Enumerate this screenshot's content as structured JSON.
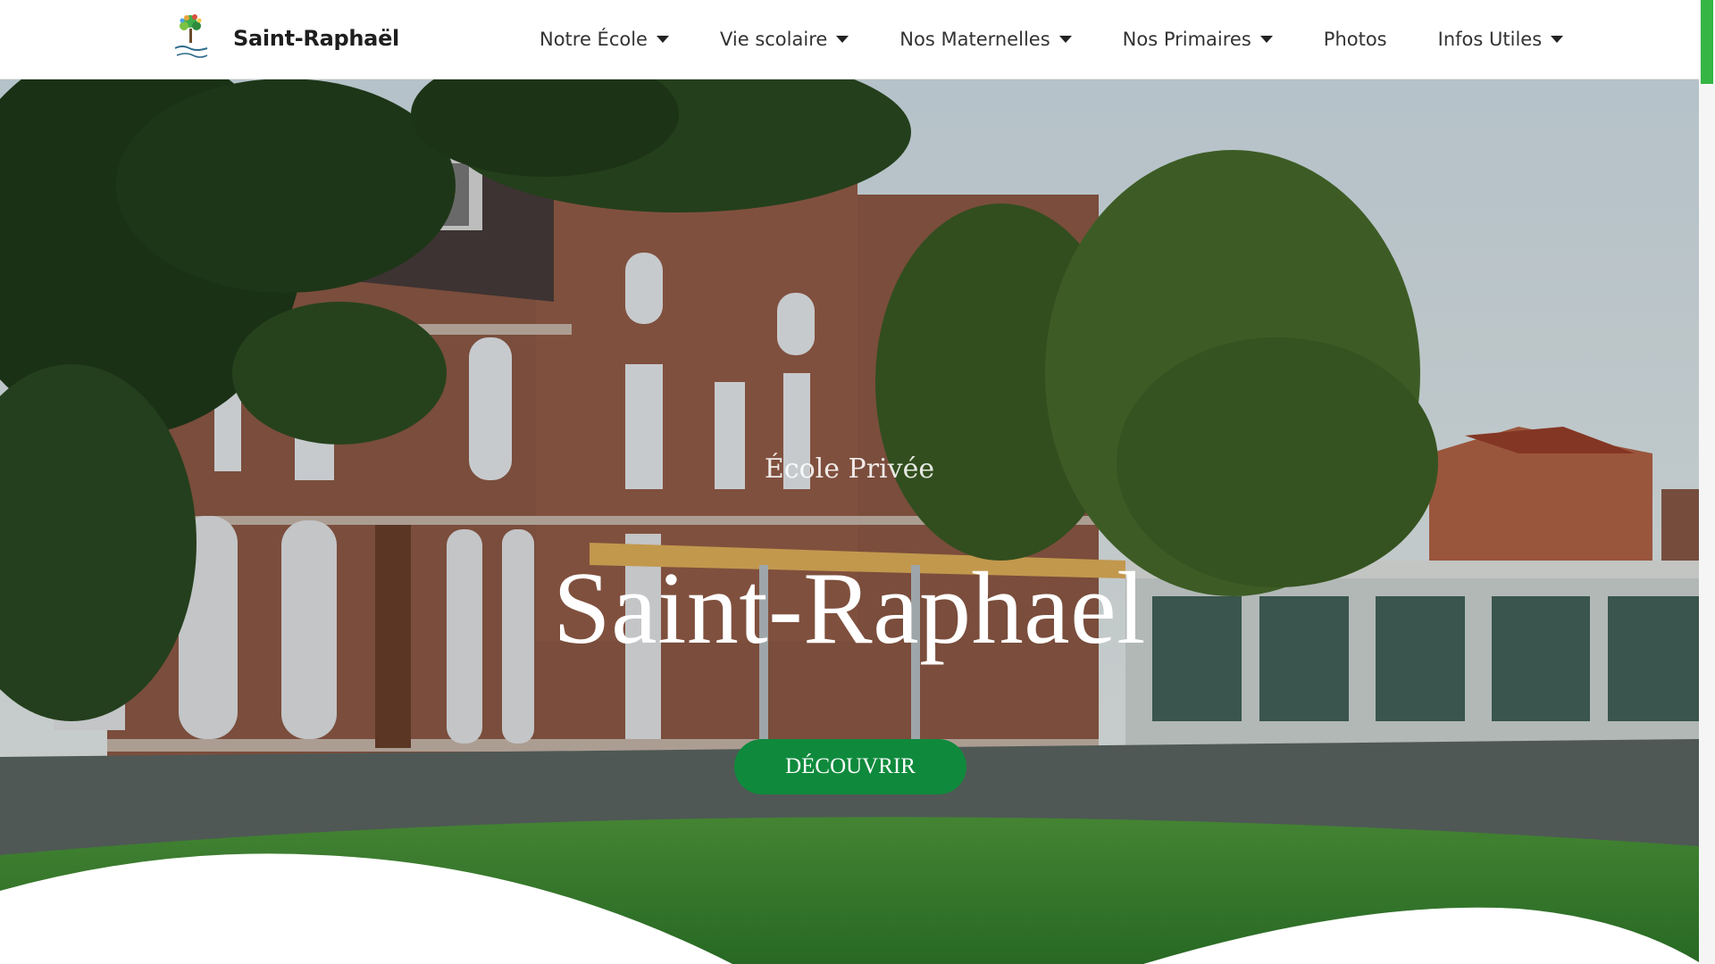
{
  "header": {
    "site_name": "Saint-Raphaël",
    "logo_text": "Saint-Raphaël"
  },
  "nav": [
    {
      "label": "Notre École",
      "dropdown": true
    },
    {
      "label": "Vie scolaire",
      "dropdown": true
    },
    {
      "label": "Nos Maternelles",
      "dropdown": true
    },
    {
      "label": "Nos Primaires",
      "dropdown": true
    },
    {
      "label": "Photos",
      "dropdown": false
    },
    {
      "label": "Infos Utiles",
      "dropdown": true
    }
  ],
  "hero": {
    "subtitle": "École Privée",
    "title": "Saint-Raphael",
    "cta_label": "DÉCOUVRIR"
  },
  "colors": {
    "accent": "#0f8a3c",
    "scroll_thumb": "#34b544"
  }
}
